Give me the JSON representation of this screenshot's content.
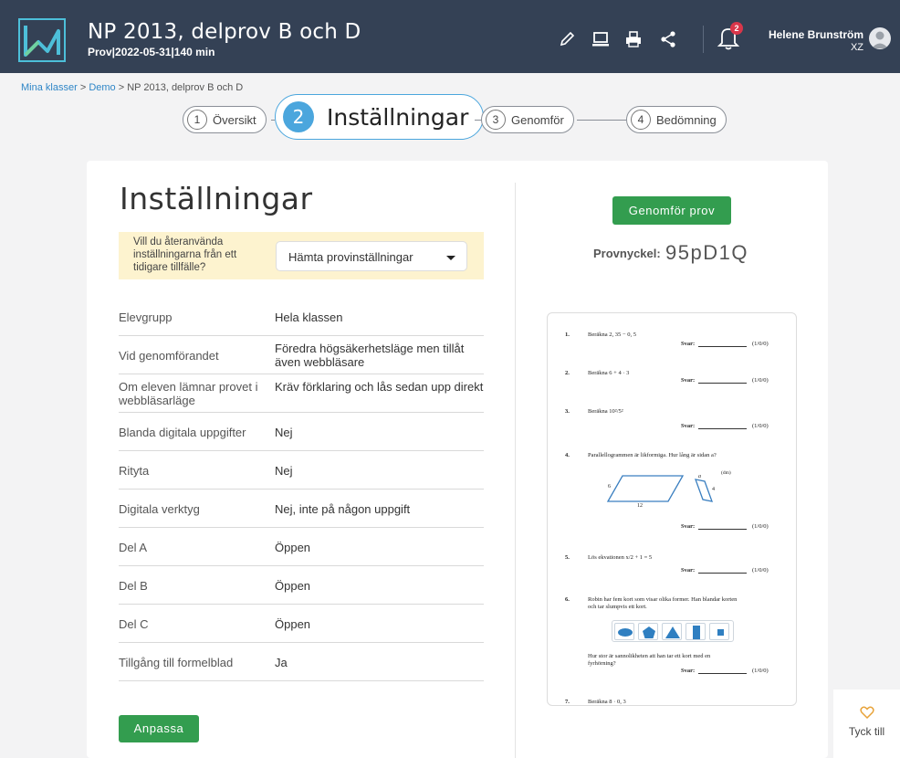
{
  "header": {
    "title": "NP 2013, delprov B och D",
    "subtitle": "Prov|2022-05-31|140 min",
    "notification_count": "2",
    "user_name": "Helene Brunström",
    "user_initials": "XZ",
    "icons": [
      "pencil-icon",
      "laptop-icon",
      "print-icon",
      "share-icon",
      "bell-icon",
      "avatar-icon"
    ]
  },
  "breadcrumb": {
    "items": [
      "Mina klasser",
      "Demo",
      "NP 2013, delprov B och D"
    ],
    "separator": ">"
  },
  "steps": [
    {
      "num": "1",
      "label": "Översikt"
    },
    {
      "num": "2",
      "label": "Inställningar"
    },
    {
      "num": "3",
      "label": "Genomför"
    },
    {
      "num": "4",
      "label": "Bedömning"
    }
  ],
  "settings": {
    "heading": "Inställningar",
    "reuse_question": "Vill du återanvända inställningarna från ett tidigare tillfälle?",
    "reuse_select": "Hämta provinställningar",
    "rows": [
      {
        "label": "Elevgrupp",
        "value": "Hela klassen"
      },
      {
        "label": "Vid genomförandet",
        "value": "Föredra högsäkerhetsläge men tillåt även webbläsare"
      },
      {
        "label": "Om eleven lämnar provet i webbläsarläge",
        "value": "Kräv förklaring och lås sedan upp direkt"
      },
      {
        "label": "Blanda digitala uppgifter",
        "value": "Nej"
      },
      {
        "label": "Rityta",
        "value": "Nej"
      },
      {
        "label": "Digitala verktyg",
        "value": "Nej, inte på någon uppgift"
      },
      {
        "label": "Del A",
        "value": "Öppen"
      },
      {
        "label": "Del B",
        "value": "Öppen"
      },
      {
        "label": "Del C",
        "value": "Öppen"
      },
      {
        "label": "Tillgång till formelblad",
        "value": "Ja"
      }
    ],
    "customize_button": "Anpassa"
  },
  "right": {
    "run_button": "Genomför prov",
    "key_label": "Provnyckel:",
    "key_value": "95pD1Q"
  },
  "preview": {
    "answer_label": "Svar:",
    "questions": [
      {
        "num": "1.",
        "text": "Beräkna 2, 35 − 0, 5",
        "points": "(1/0/0)"
      },
      {
        "num": "2.",
        "text": "Beräkna 6 + 4 · 3",
        "points": "(1/0/0)"
      },
      {
        "num": "3.",
        "text": "Beräkna 10²/5²",
        "points": "(1/0/0)"
      },
      {
        "num": "4.",
        "text": "Parallellogrammen är likformiga. Hur lång är sidan a?",
        "points": "(1/0/0)"
      },
      {
        "num": "5.",
        "text": "Lös ekvationen x/2 + 1 = 5",
        "points": "(1/0/0)"
      },
      {
        "num": "6.",
        "text": "Robin har fem kort som visar olika former. Han blandar korten och tar slumpvis ett kort.",
        "points": "(1/0/0)"
      },
      {
        "num": "7.",
        "text": "Beräkna 8 · 0, 3",
        "points": ""
      }
    ],
    "q4_labels": {
      "unit": "(dm)",
      "side_a": "a",
      "side_6": "6",
      "side_4": "4",
      "base": "12"
    },
    "q6_followup": "Hur stor är sannolikheten att han tar ett kort med en fyrhörning?"
  },
  "feedback": {
    "label": "Tyck till"
  },
  "colors": {
    "topbar": "#344155",
    "accent_blue": "#4ba6dd",
    "green": "#339d4f",
    "highlight": "#fdf3cf",
    "badge": "#d9364a"
  }
}
